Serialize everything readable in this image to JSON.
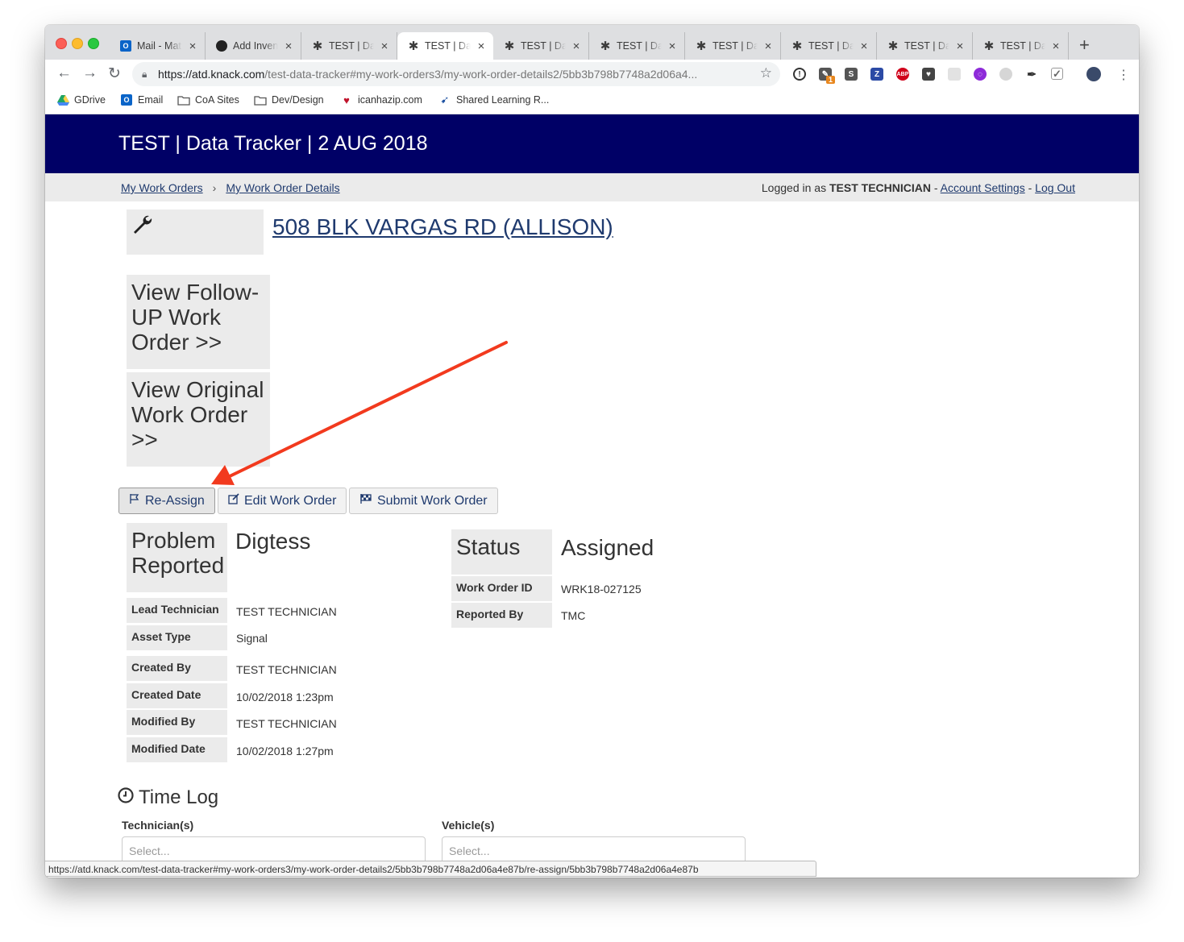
{
  "browser": {
    "tabs": [
      {
        "label": "Mail - Mat",
        "icon": "outlook-icon"
      },
      {
        "label": "Add Inven",
        "icon": "github-icon"
      },
      {
        "label": "TEST | Da",
        "icon": "asterisk-icon"
      },
      {
        "label": "TEST | Da",
        "icon": "asterisk-icon"
      },
      {
        "label": "TEST | Da",
        "icon": "asterisk-icon"
      },
      {
        "label": "TEST | Da",
        "icon": "asterisk-icon"
      },
      {
        "label": "TEST | Da",
        "icon": "asterisk-icon"
      },
      {
        "label": "TEST | Da",
        "icon": "asterisk-icon"
      },
      {
        "label": "TEST | Da",
        "icon": "asterisk-icon"
      },
      {
        "label": "TEST | Da",
        "icon": "asterisk-icon"
      }
    ],
    "active_tab": 3,
    "url_host": "https://atd.knack.com",
    "url_rest": "/test-data-tracker#my-work-orders3/my-work-order-details2/5bb3b798b7748a2d06a4...",
    "bookmarks": [
      {
        "label": "GDrive",
        "icon": "gdrive-icon"
      },
      {
        "label": "Email",
        "icon": "outlook-icon"
      },
      {
        "label": "CoA Sites",
        "icon": "folder-icon"
      },
      {
        "label": "Dev/Design",
        "icon": "folder-icon"
      },
      {
        "label": "icanhazip.com",
        "icon": "heart-icon"
      },
      {
        "label": "Shared Learning R...",
        "icon": "bird-icon"
      }
    ],
    "extension_badge": "1",
    "status_url": "https://atd.knack.com/test-data-tracker#my-work-orders3/my-work-order-details2/5bb3b798b7748a2d06a4e87b/re-assign/5bb3b798b7748a2d06a4e87b"
  },
  "app": {
    "title": "TEST | Data Tracker | 2 AUG 2018",
    "colors": {
      "header": "#000066",
      "link": "#1f3a6e",
      "annotation": "#f23a1e"
    },
    "breadcrumbs": [
      "My Work Orders",
      "My Work Order Details"
    ],
    "breadcrumb_separator": "›",
    "logged_in_prefix": "Logged in as",
    "user": "TEST TECHNICIAN",
    "dash": "-",
    "account_settings": "Account Settings",
    "log_out": "Log Out"
  },
  "work_order": {
    "location": "508 BLK VARGAS RD (ALLISON)",
    "follow_up_link": "View Follow-UP Work Order >>",
    "original_link": "View Original Work Order >>",
    "actions": {
      "reassign": "Re-Assign",
      "edit": "Edit Work Order",
      "submit": "Submit Work Order"
    },
    "problem_reported_label": "Problem Reported",
    "problem_reported": "Digtess",
    "status_label": "Status",
    "status": "Assigned",
    "left_fields": [
      {
        "label": "Lead Technician",
        "value": "TEST TECHNICIAN"
      },
      {
        "label": "Asset Type",
        "value": "Signal"
      },
      {
        "label": "Created By",
        "value": "TEST TECHNICIAN"
      },
      {
        "label": "Created Date",
        "value": "10/02/2018 1:23pm"
      },
      {
        "label": "Modified By",
        "value": "TEST TECHNICIAN"
      },
      {
        "label": "Modified Date",
        "value": "10/02/2018 1:27pm"
      }
    ],
    "right_fields": [
      {
        "label": "Work Order ID",
        "value": "WRK18-027125"
      },
      {
        "label": "Reported By",
        "value": "TMC"
      }
    ]
  },
  "time_log": {
    "title": "Time Log",
    "technicians_label": "Technician(s)",
    "technicians_placeholder": "Select...",
    "vehicles_label": "Vehicle(s)",
    "vehicles_placeholder": "Select..."
  }
}
